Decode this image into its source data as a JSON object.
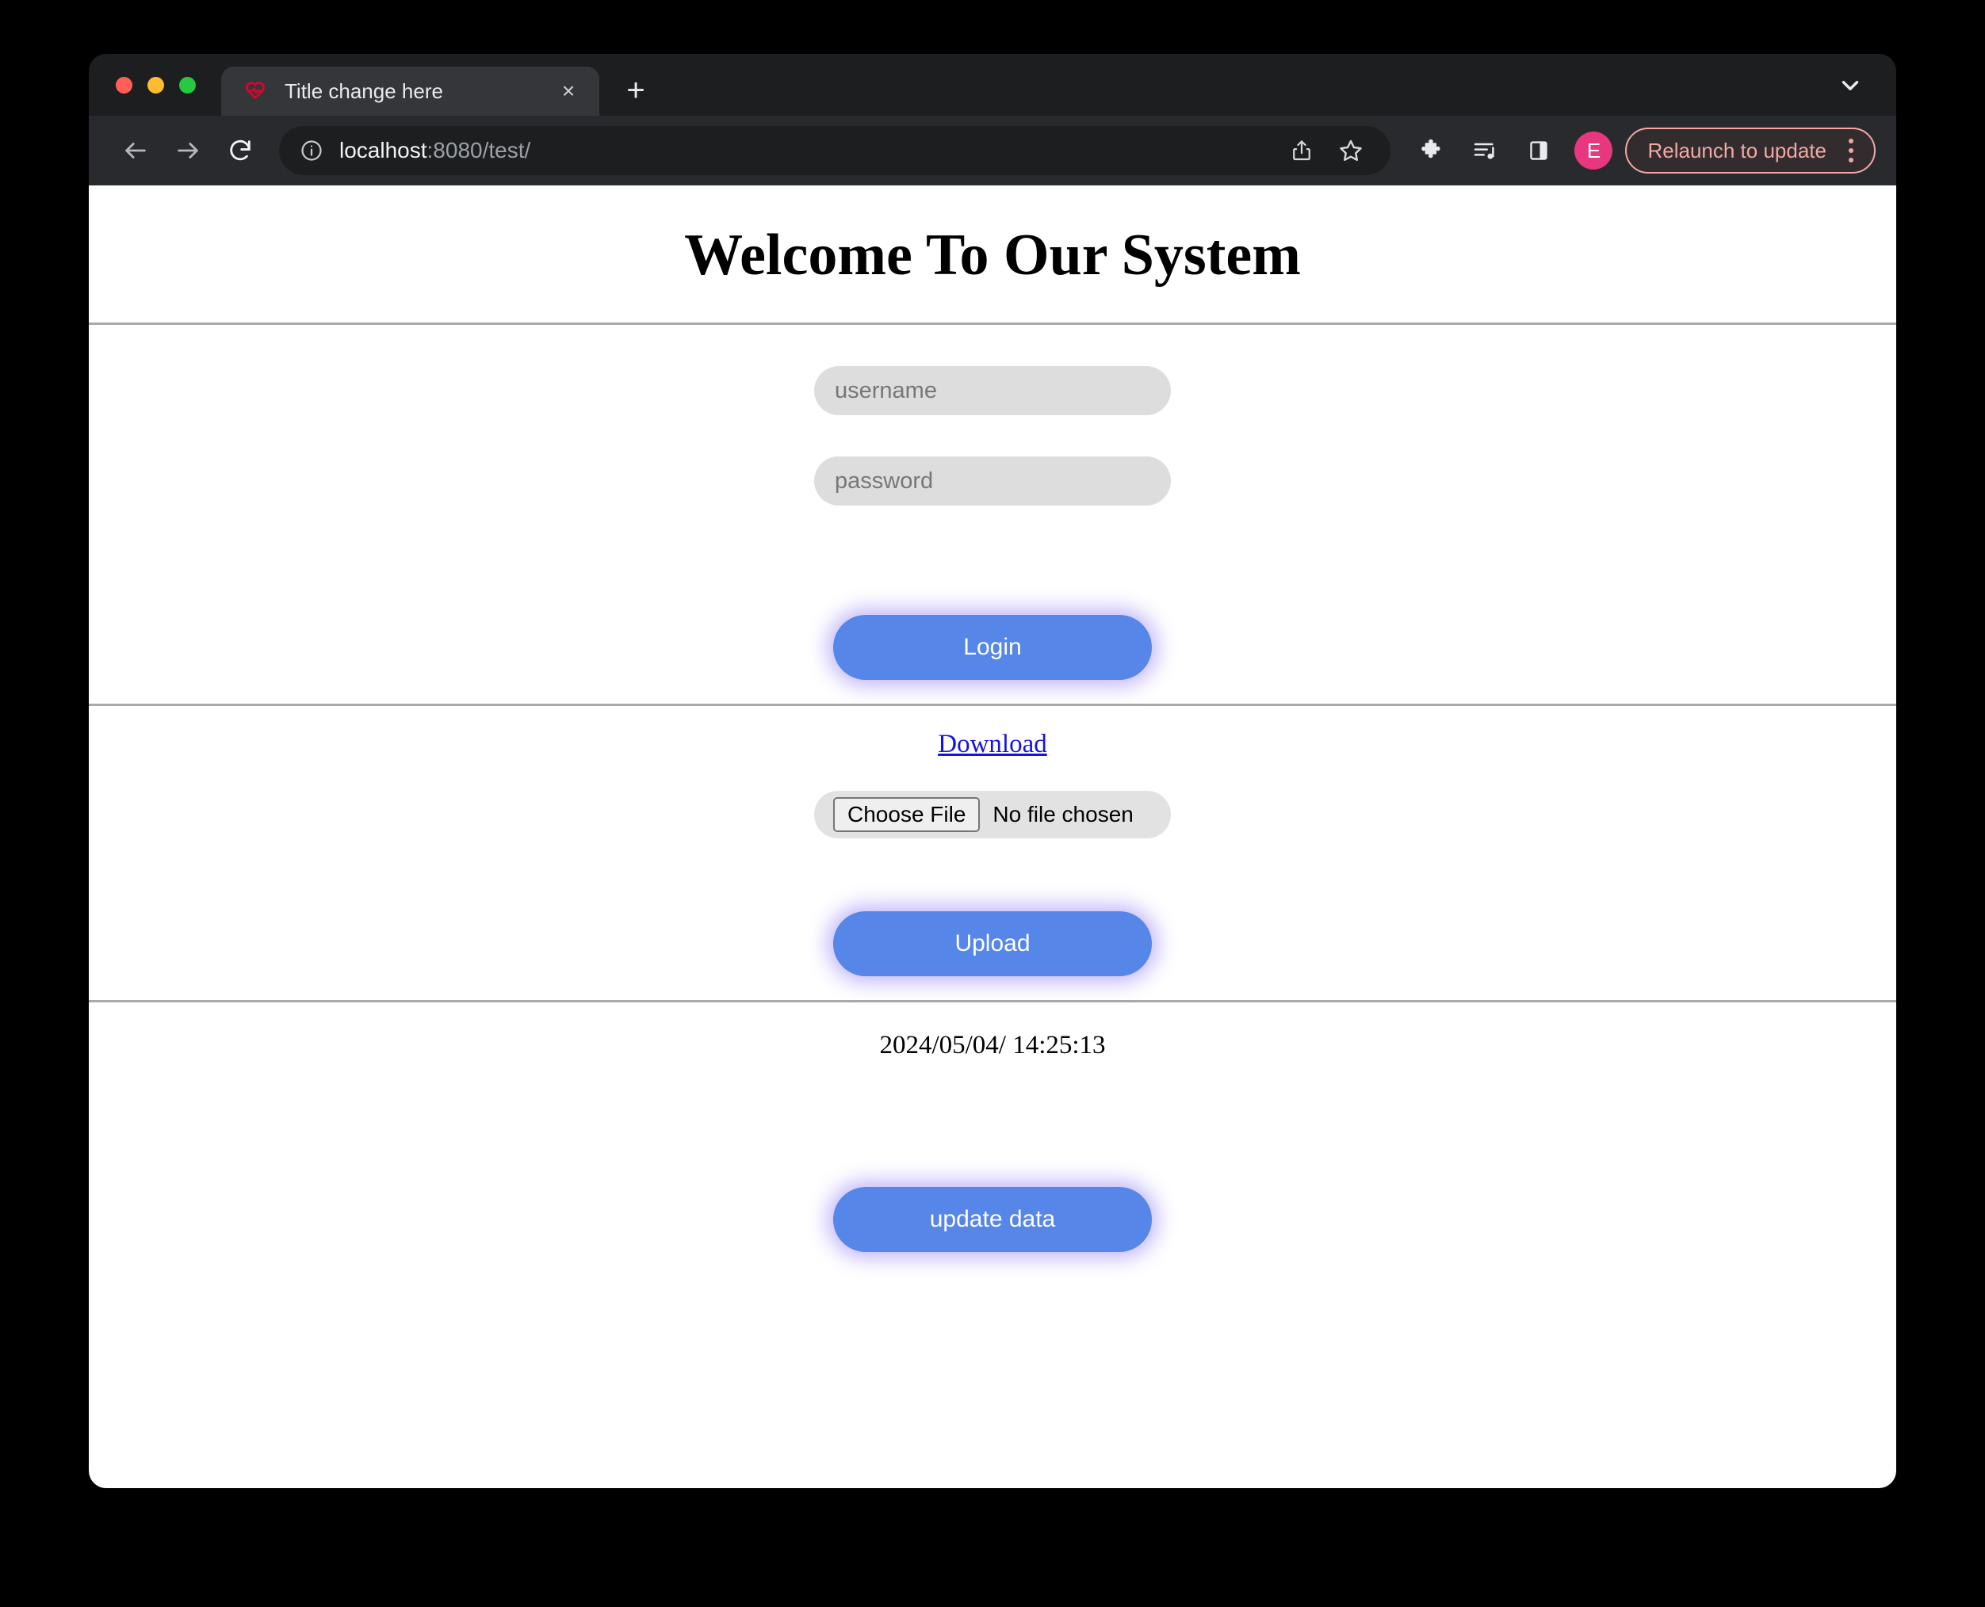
{
  "browser": {
    "traffic_lights": [
      "close",
      "minimize",
      "maximize"
    ],
    "tab": {
      "favicon": "heart-pulse-icon",
      "title": "Title change here",
      "close_label": "×"
    },
    "new_tab_label": "+",
    "tab_list_icon": "chevron-down-icon",
    "toolbar": {
      "back_icon": "arrow-left-icon",
      "forward_icon": "arrow-right-icon",
      "reload_icon": "reload-icon",
      "site_info_icon": "info-circle-icon",
      "url_host": "localhost",
      "url_rest": ":8080/test/",
      "url_full": "localhost:8080/test/",
      "share_icon": "share-icon",
      "bookmark_icon": "star-icon",
      "extensions_icon": "puzzle-piece-icon",
      "media_icon": "playlist-music-icon",
      "side_panel_icon": "side-panel-icon",
      "avatar_initial": "E",
      "relaunch_label": "Relaunch to update",
      "menu_icon": "kebab-menu-icon"
    }
  },
  "page": {
    "title": "Welcome To Our System",
    "login": {
      "username_placeholder": "username",
      "username_value": "",
      "password_placeholder": "password",
      "password_value": "",
      "submit_label": "Login"
    },
    "files": {
      "download_label": "Download",
      "choose_file_label": "Choose File",
      "file_status": "No file chosen",
      "upload_label": "Upload"
    },
    "data": {
      "timestamp": "2024/05/04/ 14:25:13",
      "update_label": "update data"
    }
  },
  "colors": {
    "accent_blue": "#5586e8",
    "glow_purple": "#7860f5",
    "link_blue": "#1414e0",
    "avatar_pink": "#e8377f",
    "relaunch_pink": "#f2a9a4",
    "input_gray": "#dddddd",
    "rule_gray": "#a9a9a9"
  }
}
